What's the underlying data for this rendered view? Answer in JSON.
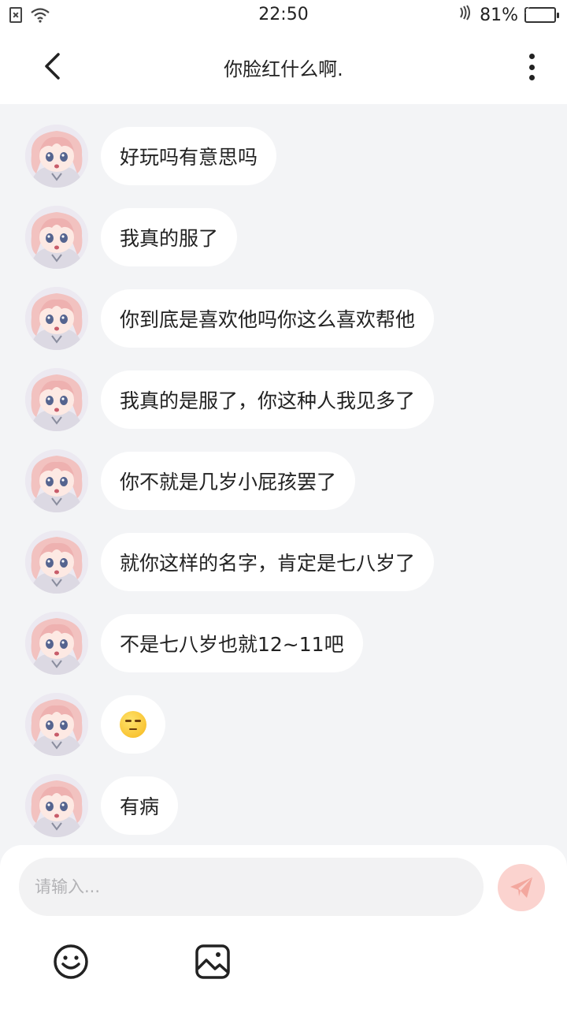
{
  "status_bar": {
    "time": "22:50",
    "battery_text": "81%",
    "battery_level": 0.81
  },
  "header": {
    "title": "你脸红什么啊."
  },
  "messages": [
    {
      "text": "好玩吗有意思吗"
    },
    {
      "text": "我真的服了"
    },
    {
      "text": "你到底是喜欢他吗你这么喜欢帮他"
    },
    {
      "text": "我真的是服了，你这种人我见多了"
    },
    {
      "text": "你不就是几岁小屁孩罢了"
    },
    {
      "text": "就你这样的名字，肯定是七八岁了"
    },
    {
      "text": "不是七八岁也就12~11吧"
    },
    {
      "emoji": "unamused-face"
    },
    {
      "text": "有病"
    }
  ],
  "composer": {
    "placeholder": "请输入..."
  },
  "icons": {
    "back": "back-chevron-icon",
    "more": "more-vertical-icon",
    "send": "paper-plane-icon",
    "emoji": "smiley-icon",
    "image": "image-icon"
  },
  "colors": {
    "send_button_bg": "#fbd3cf",
    "send_icon": "#f3a79e",
    "battery": "#2ecc40",
    "chat_bg": "#f3f4f6"
  }
}
